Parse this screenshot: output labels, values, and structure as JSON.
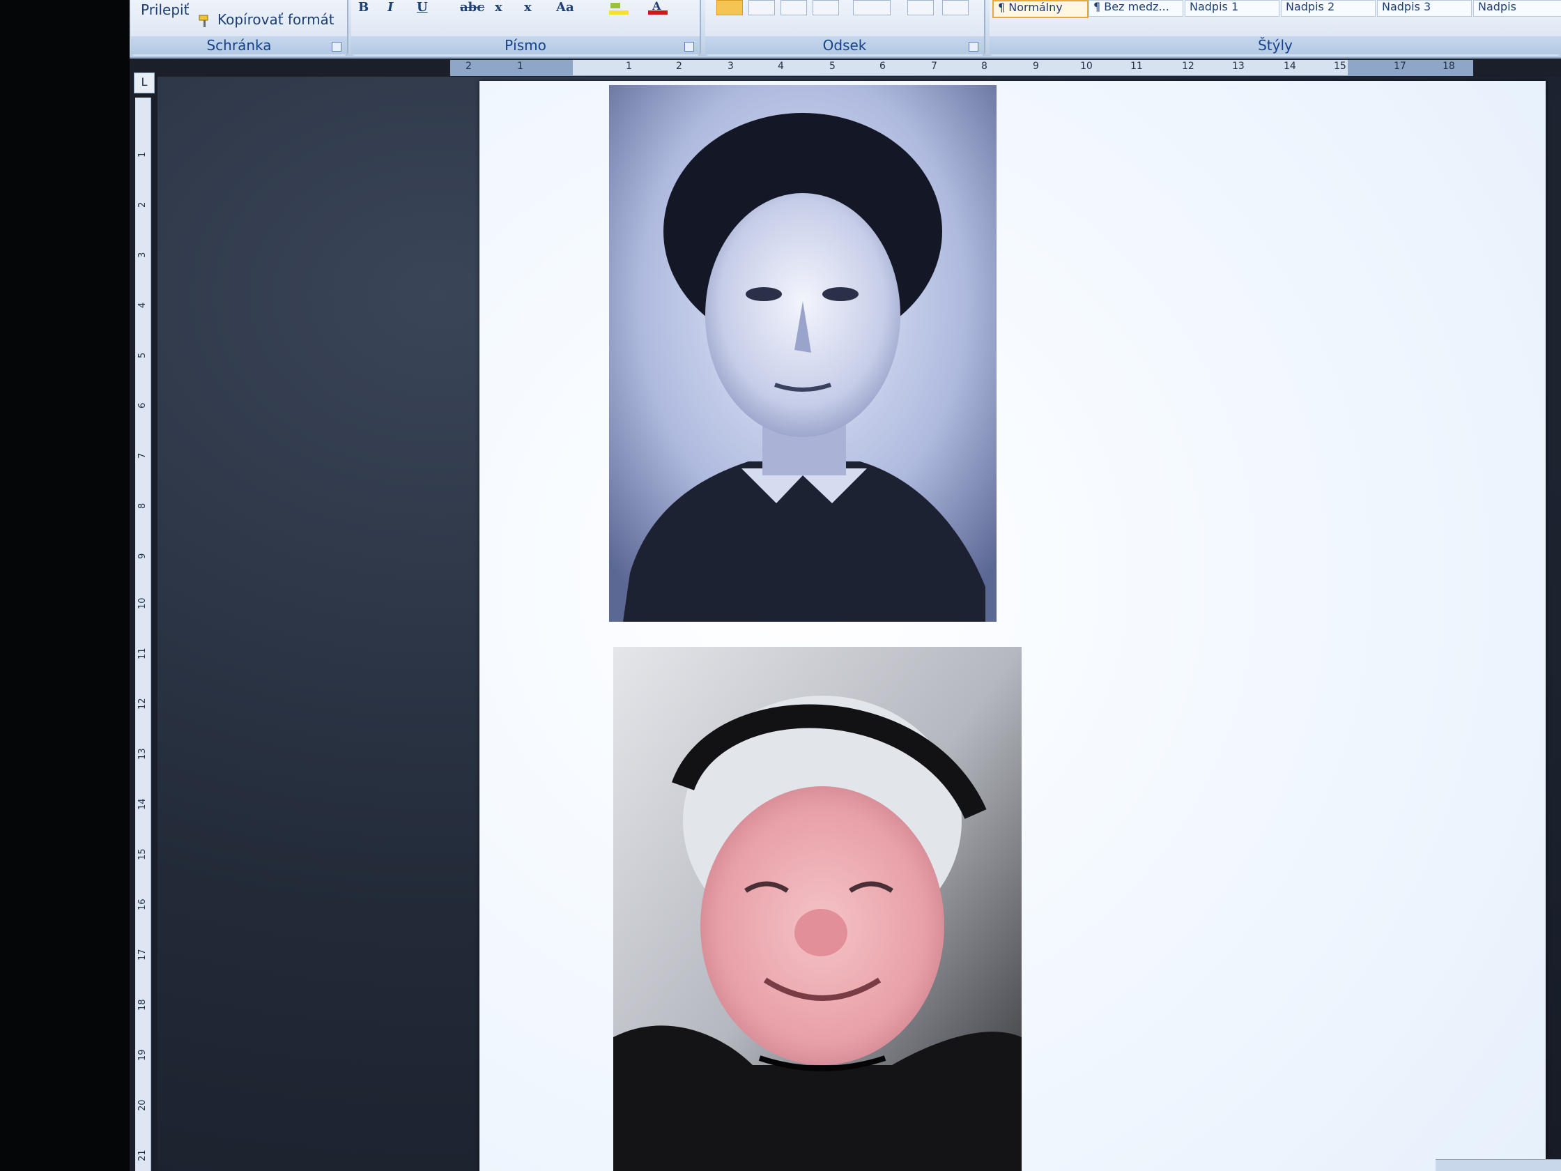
{
  "ribbon": {
    "clipboard": {
      "paste_label": "Prilepiť",
      "format_painter_label": "Kopírovať formát",
      "group_label": "Schránka"
    },
    "font": {
      "bold": "B",
      "italic": "I",
      "underline": "U",
      "strikethrough": "abc",
      "subscript": "x",
      "superscript": "x",
      "change_case": "Aa",
      "group_label": "Písmo"
    },
    "paragraph": {
      "group_label": "Odsek"
    },
    "styles": {
      "items": [
        "¶ Normálny",
        "¶ Bez medz...",
        "Nadpis 1",
        "Nadpis 2",
        "Nadpis 3",
        "Nadpis"
      ],
      "group_label": "Štýly"
    }
  },
  "ruler": {
    "horizontal_labels": [
      "2",
      "1",
      "1",
      "2",
      "3",
      "4",
      "5",
      "6",
      "7",
      "8",
      "9",
      "10",
      "11",
      "12",
      "13",
      "14",
      "15",
      "17",
      "18"
    ],
    "vertical_labels": [
      "1",
      "2",
      "3",
      "4",
      "5",
      "6",
      "7",
      "8",
      "9",
      "10",
      "11",
      "12",
      "13",
      "14",
      "15",
      "16",
      "17",
      "18",
      "19",
      "20",
      "21"
    ],
    "tab_selector": "L"
  },
  "colors": {
    "ribbon_label": "#15428b",
    "highlight": "#f6c453",
    "font_color": "#d01818"
  },
  "icons": [
    "format-painter-icon",
    "dialog-launcher-icon",
    "align-left-icon",
    "align-center-icon",
    "align-right-icon",
    "justify-icon",
    "highlight-icon",
    "font-color-icon"
  ]
}
